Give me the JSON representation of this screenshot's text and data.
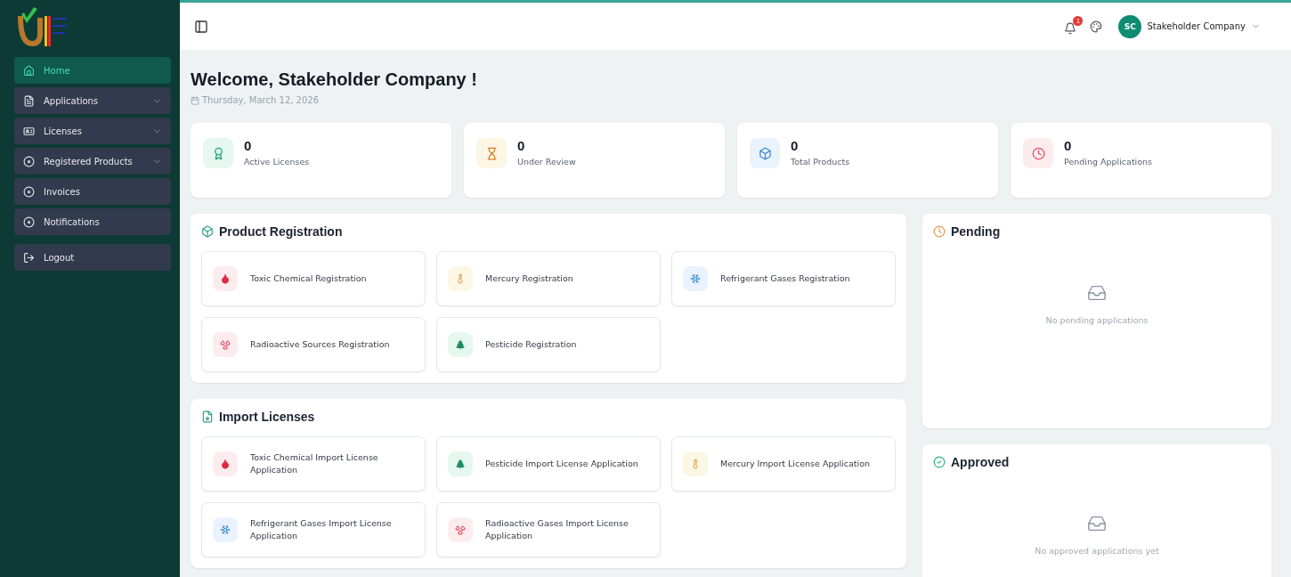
{
  "sidebar": {
    "items": [
      {
        "label": "Home",
        "selected": true,
        "expandable": false
      },
      {
        "label": "Applications",
        "selected": false,
        "expandable": true
      },
      {
        "label": "Licenses",
        "selected": false,
        "expandable": true
      },
      {
        "label": "Registered Products",
        "selected": false,
        "expandable": true
      },
      {
        "label": "Invoices",
        "selected": false,
        "expandable": false
      },
      {
        "label": "Notifications",
        "selected": false,
        "expandable": false
      }
    ],
    "logout": "Logout"
  },
  "header": {
    "notification_count": "1",
    "avatar": "SC",
    "user": "Stakeholder Company"
  },
  "welcome": {
    "title": "Welcome, Stakeholder Company !",
    "date": "Thursday, March 12, 2026"
  },
  "stats": [
    {
      "value": "0",
      "label": "Active Licenses"
    },
    {
      "value": "0",
      "label": "Under Review"
    },
    {
      "value": "0",
      "label": "Total Products"
    },
    {
      "value": "0",
      "label": "Pending Applications"
    }
  ],
  "sections": [
    {
      "title": "Product Registration",
      "items": [
        {
          "label": "Toxic Chemical Registration",
          "kind": "toxic"
        },
        {
          "label": "Mercury Registration",
          "kind": "mercury"
        },
        {
          "label": "Refrigerant Gases Registration",
          "kind": "refrigerant"
        },
        {
          "label": "Radioactive Sources Registration",
          "kind": "radioactive"
        },
        {
          "label": "Pesticide Registration",
          "kind": "pesticide"
        }
      ]
    },
    {
      "title": "Import Licenses",
      "items": [
        {
          "label": "Toxic Chemical Import License Application",
          "kind": "toxic"
        },
        {
          "label": "Pesticide Import License Application",
          "kind": "pesticide"
        },
        {
          "label": "Mercury Import License Application",
          "kind": "mercury"
        },
        {
          "label": "Refrigerant Gases Import License Application",
          "kind": "refrigerant"
        },
        {
          "label": "Radioactive Gases Import License Application",
          "kind": "radioactive"
        }
      ]
    }
  ],
  "status_panels": [
    {
      "title": "Pending",
      "empty_text": "No pending applications"
    },
    {
      "title": "Approved",
      "empty_text": "No approved applications yet"
    }
  ]
}
